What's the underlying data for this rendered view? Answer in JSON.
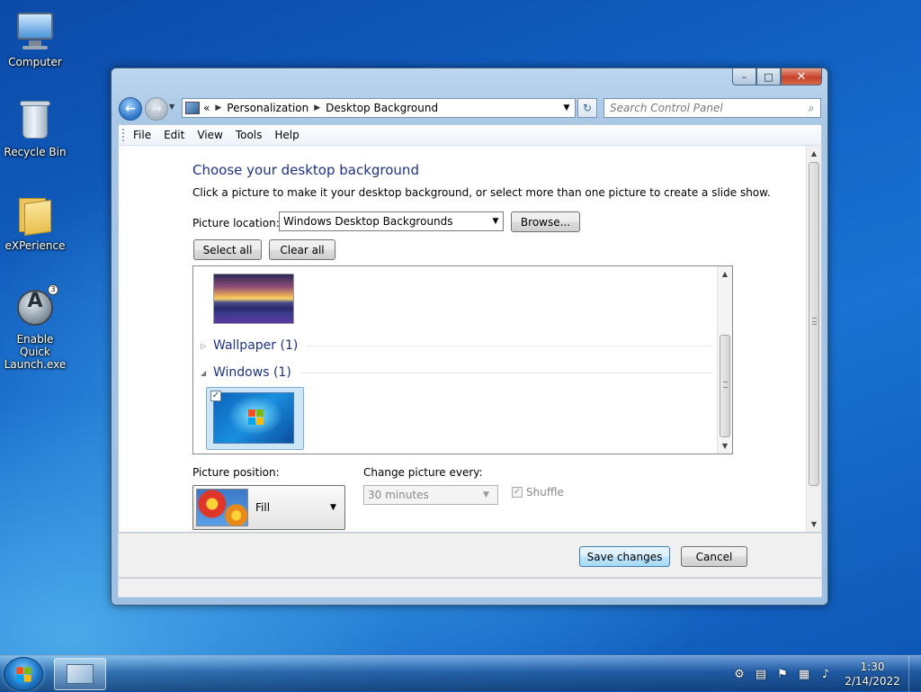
{
  "desktop": {
    "icons": [
      {
        "label": "Computer"
      },
      {
        "label": "Recycle Bin"
      },
      {
        "label": "eXPerience"
      },
      {
        "label": "Enable Quick Launch.exe"
      }
    ]
  },
  "window": {
    "controls": {
      "minimize": "–",
      "maximize": "□",
      "close": "✕"
    },
    "address": {
      "overflow": "«",
      "crumbs": [
        "Personalization",
        "Desktop Background"
      ]
    },
    "search": {
      "placeholder": "Search Control Panel"
    },
    "menu": [
      "File",
      "Edit",
      "View",
      "Tools",
      "Help"
    ]
  },
  "page": {
    "title": "Choose your desktop background",
    "subtitle": "Click a picture to make it your desktop background, or select more than one picture to create a slide show.",
    "picture_location": {
      "label": "Picture location:",
      "value": "Windows Desktop Backgrounds"
    },
    "browse_label": "Browse...",
    "select_all_label": "Select all",
    "clear_all_label": "Clear all",
    "groups": [
      {
        "name": "Wallpaper (1)",
        "expanded": false
      },
      {
        "name": "Windows (1)",
        "expanded": true
      }
    ],
    "picture_position": {
      "label": "Picture position:",
      "value": "Fill"
    },
    "change_picture": {
      "label": "Change picture every:",
      "value": "30 minutes"
    },
    "shuffle": {
      "label": "Shuffle",
      "checked": true,
      "enabled": false
    },
    "save_label": "Save changes",
    "cancel_label": "Cancel"
  },
  "taskbar": {
    "clock": {
      "time": "1:30",
      "date": "2/14/2022"
    }
  },
  "colors": {
    "heading": "#1e3287",
    "desktop": "#1567c8"
  }
}
